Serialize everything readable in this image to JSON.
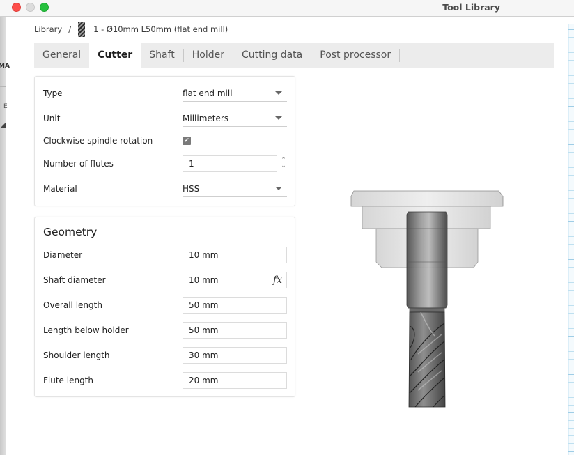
{
  "window": {
    "title": "Tool Library"
  },
  "breadcrumb": {
    "root": "Library",
    "separator": "/",
    "tool_icon": "flat-end-mill-icon",
    "current": "1 - Ø10mm L50mm (flat end mill)"
  },
  "tabs": [
    {
      "label": "General",
      "active": false
    },
    {
      "label": "Cutter",
      "active": true
    },
    {
      "label": "Shaft",
      "active": false
    },
    {
      "label": "Holder",
      "active": false
    },
    {
      "label": "Cutting data",
      "active": false
    },
    {
      "label": "Post processor",
      "active": false
    }
  ],
  "cutter": {
    "type": {
      "label": "Type",
      "value": "flat end mill"
    },
    "unit": {
      "label": "Unit",
      "value": "Millimeters"
    },
    "clockwise": {
      "label": "Clockwise spindle rotation",
      "checked": true,
      "check_glyph": "✔"
    },
    "flutes": {
      "label": "Number of flutes",
      "value": "1",
      "up_glyph": "⌃",
      "down_glyph": "⌄"
    },
    "material": {
      "label": "Material",
      "value": "HSS"
    }
  },
  "geometry": {
    "title": "Geometry",
    "fields": [
      {
        "label": "Diameter",
        "value": "10 mm"
      },
      {
        "label": "Shaft diameter",
        "value": "10 mm",
        "expression_icon": "fx"
      },
      {
        "label": "Overall length",
        "value": "50 mm"
      },
      {
        "label": "Length below holder",
        "value": "50 mm"
      },
      {
        "label": "Shoulder length",
        "value": "30 mm"
      },
      {
        "label": "Flute length",
        "value": "20 mm"
      }
    ]
  },
  "background_fragments": {
    "left_text_1": "MA",
    "left_text_2": "E"
  },
  "colors": {
    "tab_bar": "#ececec",
    "active_tab": "#ffffff",
    "checkbox": "#7a7a7a",
    "ruler": "#bfe0f0"
  }
}
